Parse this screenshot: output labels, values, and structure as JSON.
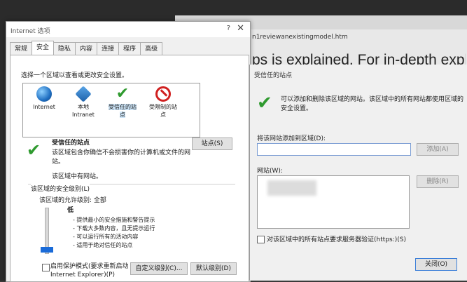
{
  "browser": {
    "url_fragment": "n1reviewanexistingmodel.htm",
    "heading": "ps is explained. For in-depth expl",
    "close_glyph": "✕",
    "side_glyph": "a"
  },
  "dialog": {
    "title": "Internet 选项",
    "help": "?",
    "close": "✕",
    "tabs": [
      "常规",
      "安全",
      "隐私",
      "内容",
      "连接",
      "程序",
      "高级"
    ],
    "active_tab": "安全",
    "instruction": "选择一个区域以查看或更改安全设置。",
    "zones": [
      {
        "label": "Internet",
        "icon": "globe-icon"
      },
      {
        "label": "本地\nIntranet",
        "icon": "local-intranet-icon"
      },
      {
        "label": "受信任的站\n点",
        "icon": "checkmark-icon"
      },
      {
        "label": "受限制的站\n点",
        "icon": "no-entry-icon"
      }
    ],
    "zone_title": "受信任的站点",
    "zone_desc": "该区域包含你确信不会损害你的计算机或文件的网站。",
    "zone_note": "该区域中有网站。",
    "sites_button": "站点(S)",
    "security_level_label": "该区域的安全级别(L)",
    "allowed_levels": "该区域的允许级别: 全部",
    "level_name": "低",
    "bullets": [
      "- 提供最小的安全措施和警告提示",
      "- 下载大多数内容，且无提示运行",
      "- 可以运行所有的活动内容",
      "- 适用于绝对信任的站点"
    ],
    "protect_mode_label": "启用保护模式(要求重新启动\nInternet Explorer)(P)",
    "custom_level_button": "自定义级别(C)...",
    "default_level_button": "默认级别(D)"
  },
  "trusted": {
    "title": "受信任的站点",
    "description": "可以添加和删除该区域的网站。该区域中的所有网站都使用区域的安全设置。",
    "add_label": "将该网站添加到区域(D):",
    "add_value": "",
    "add_button": "添加(A)",
    "sites_label": "网站(W):",
    "remove_button": "删除(R)",
    "https_label": "对该区域中的所有站点要求服务器验证(https:)(S)",
    "close_button": "关闭(O)"
  }
}
